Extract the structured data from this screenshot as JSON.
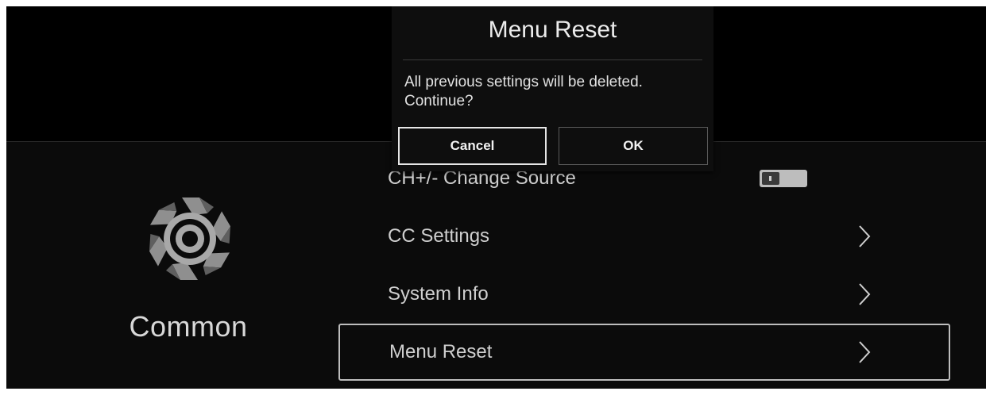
{
  "category": {
    "label": "Common",
    "icon": "gear-icon"
  },
  "menu": {
    "items": [
      {
        "label": "CH+/- Change Source",
        "control": "toggle",
        "toggle_state": "off"
      },
      {
        "label": "CC Settings",
        "control": "chevron-right-icon"
      },
      {
        "label": "System Info",
        "control": "chevron-right-icon"
      },
      {
        "label": "Menu Reset",
        "control": "chevron-right-icon",
        "focused": true
      }
    ]
  },
  "dialog": {
    "title": "Menu Reset",
    "message_line1": "All previous settings will be deleted.",
    "message_line2": "Continue?",
    "cancel_label": "Cancel",
    "ok_label": "OK"
  },
  "colors": {
    "background": "#000000",
    "text": "#cfcfcf",
    "focus_border": "#bdbdbd",
    "gear": "#9a9a9a"
  }
}
